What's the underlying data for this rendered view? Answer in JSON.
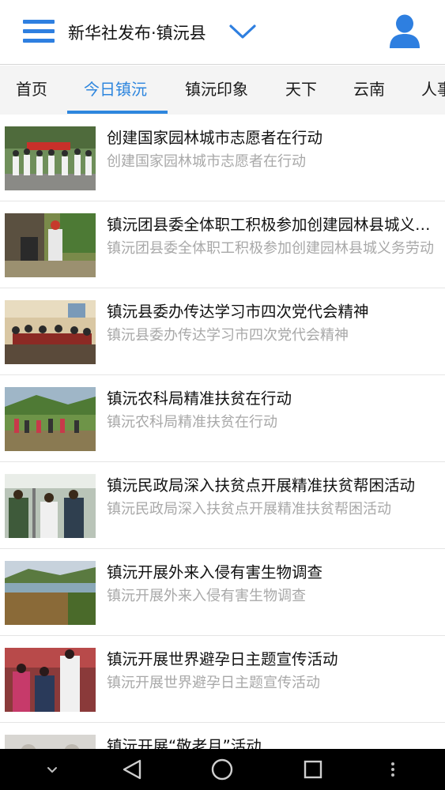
{
  "header": {
    "title": "新华社发布·镇沅县",
    "menu_icon": "hamburger-menu-icon",
    "dropdown_icon": "chevron-down-icon",
    "user_icon": "user-avatar-icon",
    "accent_color": "#2e7fe0"
  },
  "tabs": [
    {
      "label": "首页",
      "active": false
    },
    {
      "label": "今日镇沅",
      "active": true
    },
    {
      "label": "镇沅印象",
      "active": false
    },
    {
      "label": "天下",
      "active": false
    },
    {
      "label": "云南",
      "active": false
    },
    {
      "label": "人事",
      "active": false
    }
  ],
  "articles": [
    {
      "title": "创建国家园林城市志愿者在行动",
      "summary": "创建国家园林城市志愿者在行动"
    },
    {
      "title": "镇沅团县委全体职工积极参加创建园林县城义务劳动",
      "summary": "镇沅团县委全体职工积极参加创建园林县城义务劳动"
    },
    {
      "title": "镇沅县委办传达学习市四次党代会精神",
      "summary": "镇沅县委办传达学习市四次党代会精神"
    },
    {
      "title": "镇沅农科局精准扶贫在行动",
      "summary": "镇沅农科局精准扶贫在行动"
    },
    {
      "title": "镇沅民政局深入扶贫点开展精准扶贫帮困活动",
      "summary": "镇沅民政局深入扶贫点开展精准扶贫帮困活动"
    },
    {
      "title": "镇沅开展外来入侵有害生物调查",
      "summary": "镇沅开展外来入侵有害生物调查"
    },
    {
      "title": "镇沅开展世界避孕日主题宣传活动",
      "summary": "镇沅开展世界避孕日主题宣传活动"
    },
    {
      "title": "镇沅开展“敬老月”活动",
      "summary": ""
    }
  ],
  "navbar": {
    "icons": [
      "hide-keyboard-chevron-icon",
      "back-triangle-icon",
      "home-circle-icon",
      "recents-square-icon",
      "overflow-dots-icon"
    ]
  }
}
